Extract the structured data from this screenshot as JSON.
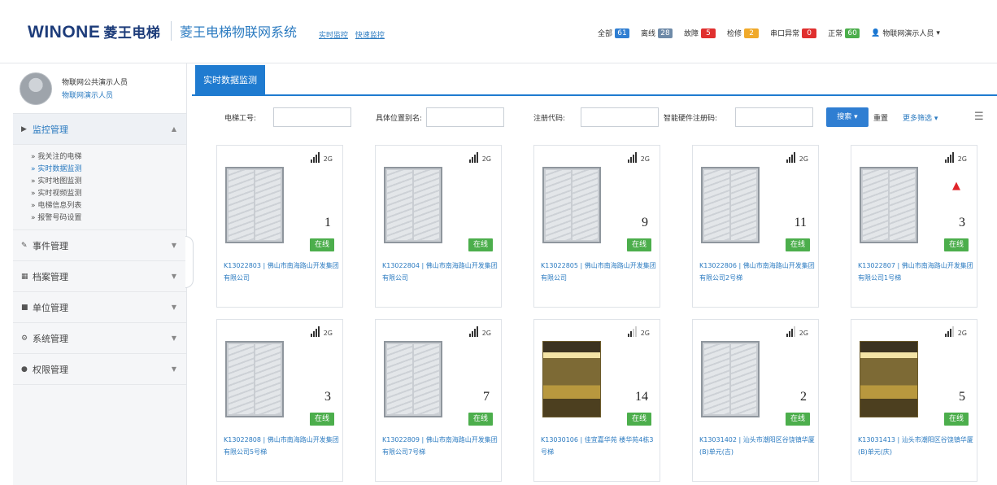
{
  "header": {
    "logo_text": "WINONE",
    "logo_cn": "菱王电梯",
    "system_name": "菱王电梯物联网系统",
    "sublinks": [
      "实时监控",
      "快速监控"
    ],
    "statuses": [
      {
        "label": "全部",
        "count": "61",
        "color": "#2f7ed2"
      },
      {
        "label": "离线",
        "count": "28",
        "color": "#6e8aa8"
      },
      {
        "label": "故障",
        "count": "5",
        "color": "#e0302f"
      },
      {
        "label": "检修",
        "count": "2",
        "color": "#f0a92a"
      },
      {
        "label": "串口异常",
        "count": "0",
        "color": "#e0302f"
      },
      {
        "label": "正常",
        "count": "60",
        "color": "#4cae4c"
      }
    ],
    "user": "物联网演示人员"
  },
  "sidebar": {
    "profile_name": "物联网公共演示人员",
    "profile_role": "物联网演示人员",
    "groups": [
      {
        "label": "监控管理",
        "active": true,
        "items": [
          "我关注的电梯",
          "实时数据监测",
          "实时地图监测",
          "实时视频监测",
          "电梯信息列表",
          "报警号码设置"
        ]
      },
      {
        "label": "事件管理"
      },
      {
        "label": "档案管理"
      },
      {
        "label": "单位管理"
      },
      {
        "label": "系统管理"
      },
      {
        "label": "权限管理"
      }
    ]
  },
  "main": {
    "tab": "实时数据监测",
    "filters": {
      "elevator_no": "电梯工号:",
      "location": "具体位置别名:",
      "reg_code": "注册代码:",
      "hw_code": "智能硬件注册码:",
      "search": "搜索",
      "reset": "重置",
      "more": "更多筛选"
    }
  },
  "cards": [
    {
      "signal_bars": 4,
      "net": "2G",
      "image": "doors",
      "floor": "1",
      "status": "在线",
      "caption": "K13022803 | 佛山市南海路山开发集团有限公司",
      "arrow": false
    },
    {
      "signal_bars": 4,
      "net": "2G",
      "image": "doors",
      "floor": "",
      "status": "在线",
      "caption": "K13022804 | 佛山市南海路山开发集团有限公司",
      "arrow": false
    },
    {
      "signal_bars": 4,
      "net": "2G",
      "image": "doors",
      "floor": "9",
      "status": "在线",
      "caption": "K13022805 | 佛山市南海路山开发集团有限公司",
      "arrow": false
    },
    {
      "signal_bars": 4,
      "net": "2G",
      "image": "doors",
      "floor": "11",
      "status": "在线",
      "caption": "K13022806 | 佛山市南海路山开发集团有限公司2号梯",
      "arrow": false
    },
    {
      "signal_bars": 4,
      "net": "2G",
      "image": "doors",
      "floor": "3",
      "status": "在线",
      "caption": "K13022807 | 佛山市南海路山开发集团有限公司1号梯",
      "arrow": true
    },
    {
      "signal_bars": 4,
      "net": "2G",
      "image": "doors",
      "floor": "3",
      "status": "在线",
      "caption": "K13022808 | 佛山市南海路山开发集团有限公司5号梯",
      "arrow": false
    },
    {
      "signal_bars": 4,
      "net": "2G",
      "image": "doors",
      "floor": "7",
      "status": "在线",
      "caption": "K13022809 | 佛山市南海路山开发集团有限公司7号梯",
      "arrow": false
    },
    {
      "signal_bars": 2,
      "net": "2G",
      "image": "cabin",
      "floor": "14",
      "status": "在线",
      "caption": "K13030106 | 佳宜嘉华苑 楼华苑4栋3号梯",
      "arrow": false
    },
    {
      "signal_bars": 3,
      "net": "2G",
      "image": "doors",
      "floor": "2",
      "status": "在线",
      "caption": "K13031402 | 汕头市潮阳区谷饶镇华厦(B)单元(吉)",
      "arrow": false
    },
    {
      "signal_bars": 3,
      "net": "2G",
      "image": "cabin",
      "floor": "5",
      "status": "在线",
      "caption": "K13031413 | 汕头市潮阳区谷饶镇华厦(B)单元(庆)",
      "arrow": false
    }
  ]
}
